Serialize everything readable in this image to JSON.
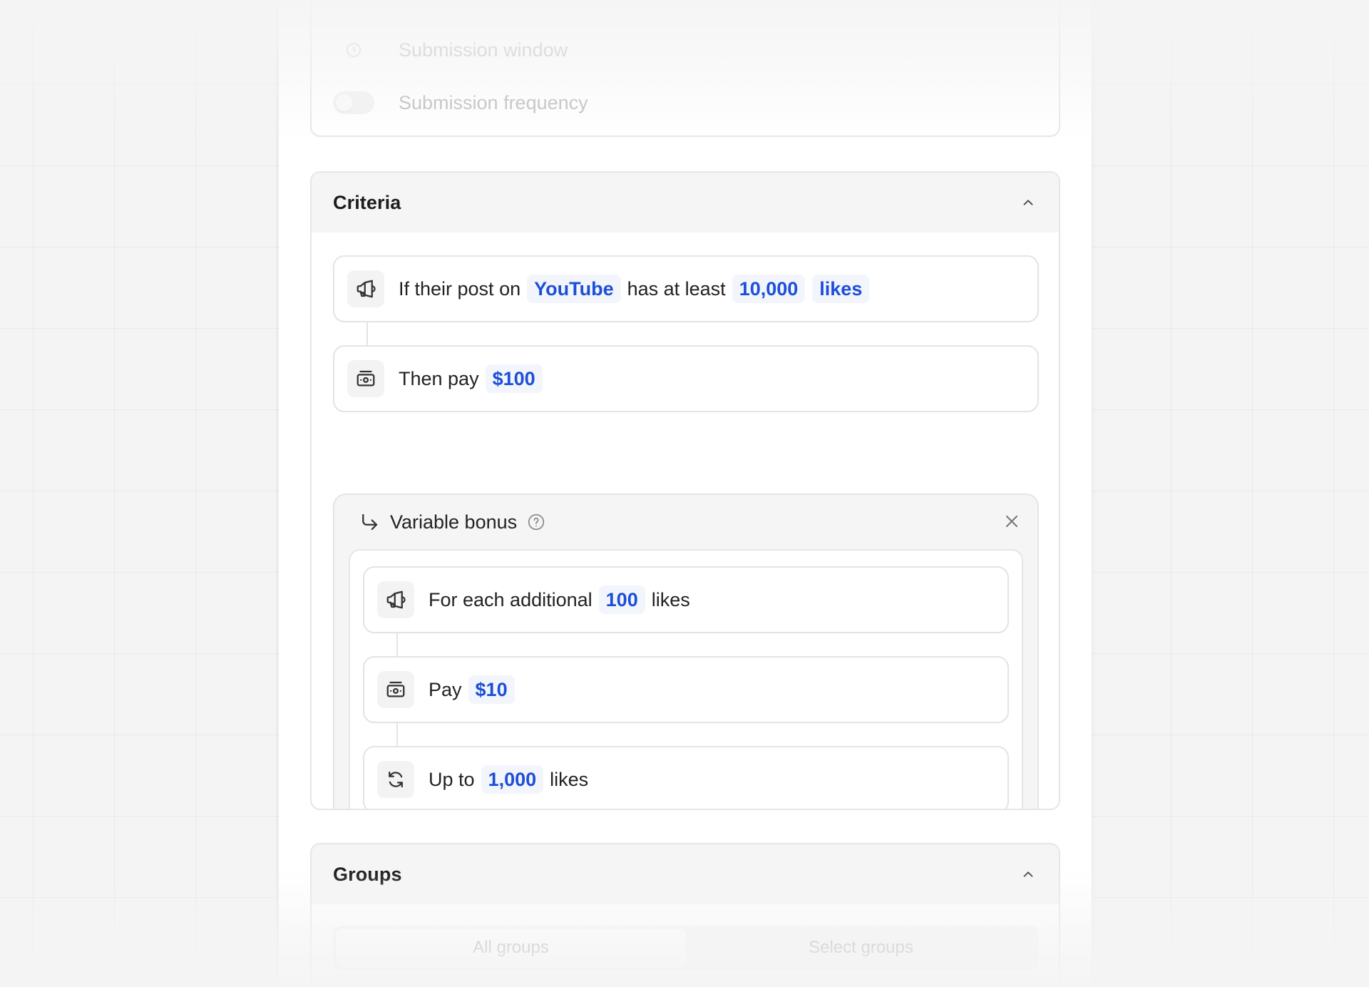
{
  "settings": {
    "submission_window_label": "Submission window",
    "submission_frequency_label": "Submission frequency"
  },
  "criteria": {
    "title": "Criteria",
    "condition": {
      "prefix": "If their post on",
      "platform": "YouTube",
      "middle": "has at least",
      "count": "10,000",
      "metric": "likes",
      "icon": "megaphone-icon"
    },
    "payout": {
      "prefix": "Then pay",
      "amount": "$100",
      "icon": "banknote-icon"
    },
    "variable_bonus": {
      "title": "Variable bonus",
      "each": {
        "prefix": "For each additional",
        "count": "100",
        "metric": "likes",
        "icon": "megaphone-icon"
      },
      "pay": {
        "prefix": "Pay",
        "amount": "$10",
        "icon": "banknote-icon"
      },
      "cap": {
        "prefix": "Up to",
        "count": "1,000",
        "metric": "likes",
        "icon": "refresh-icon"
      }
    }
  },
  "groups": {
    "title": "Groups",
    "options": [
      "All groups",
      "Select groups"
    ]
  },
  "colors": {
    "accent": "#1d4ed8",
    "pill_bg": "#f2f5fb",
    "header_bg": "#f5f5f5",
    "border": "#e4e4e4"
  }
}
